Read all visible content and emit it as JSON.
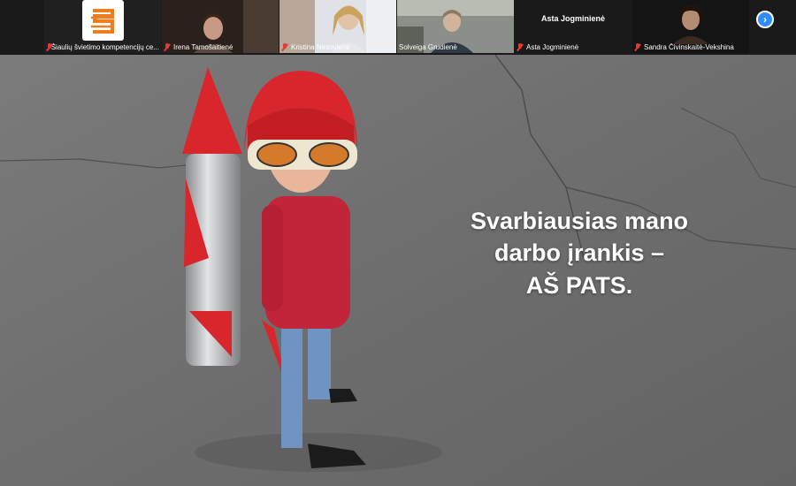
{
  "participants": [
    {
      "name": "Šiaulių švietimo kompetencijų ce...",
      "muted": true
    },
    {
      "name": "Irena Tamošaitienė",
      "muted": true
    },
    {
      "name": "Kristina Nesovienė",
      "muted": true
    },
    {
      "name": "Solveiga Grudienė",
      "muted": false,
      "active": true
    },
    {
      "name": "Asta Jogminienė",
      "muted": true,
      "display_name": "Asta Jogminienė"
    },
    {
      "name": "Sandra Čivinskaitė-Vekshina",
      "muted": true
    }
  ],
  "slide": {
    "lines": [
      "Svarbiausias mano",
      "darbo įrankis –",
      "AŠ PATS."
    ]
  },
  "colors": {
    "active_border": "#2fc46b",
    "next_button": "#2d8cff",
    "logo_orange": "#f07c1e",
    "helmet_red": "#d9262c",
    "shirt_red": "#c2243a"
  }
}
